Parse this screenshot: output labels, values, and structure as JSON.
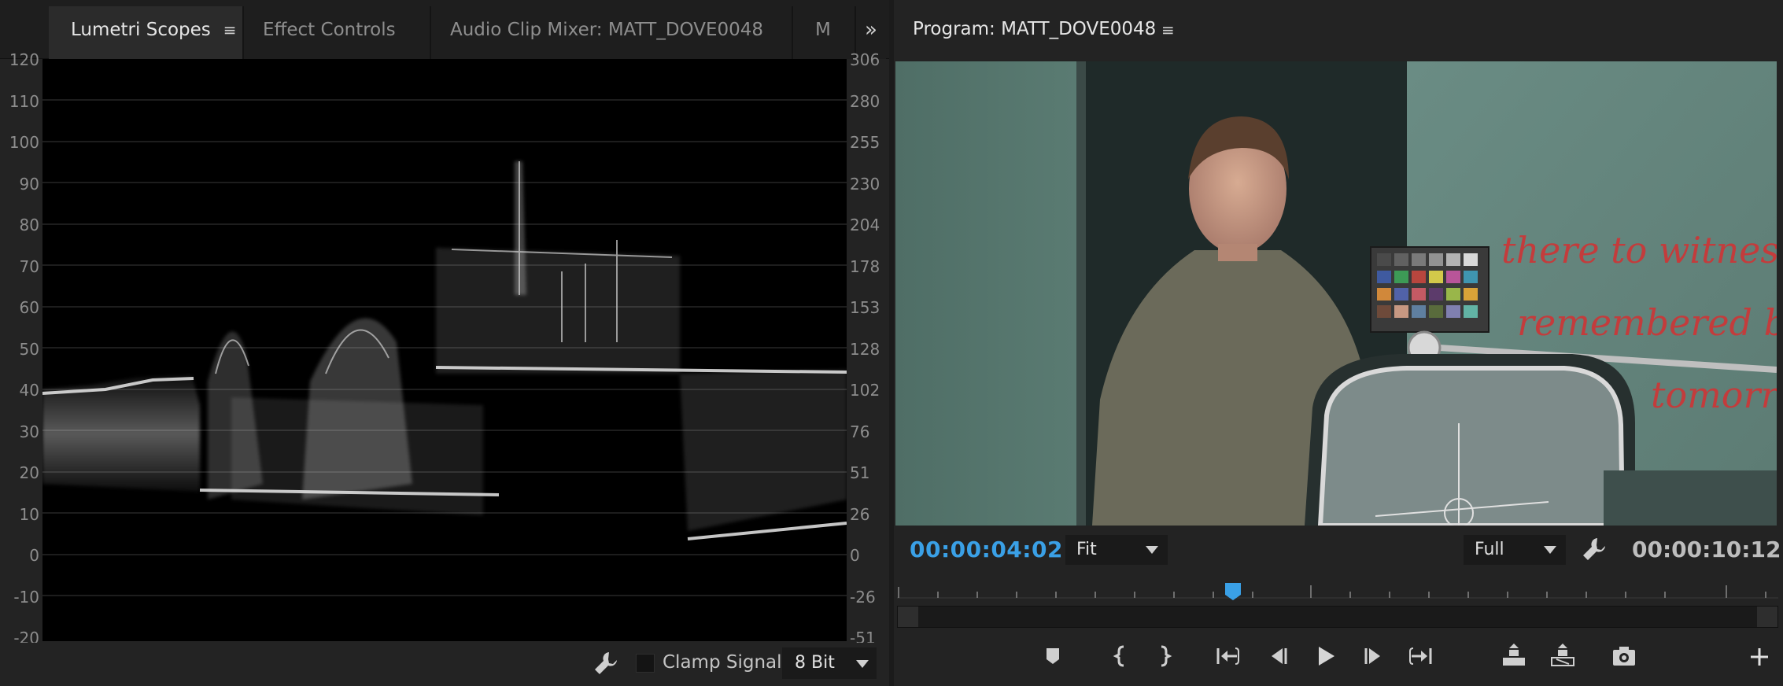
{
  "scopes_panel": {
    "tabs": [
      {
        "label": "Lumetri Scopes",
        "active": true
      },
      {
        "label": "Effect Controls",
        "active": false
      },
      {
        "label": "Audio Clip Mixer: MATT_DOVE0048",
        "active": false
      },
      {
        "label": "M",
        "active": false
      }
    ],
    "menu_glyph": "≡",
    "overflow_glyph": "»",
    "left_axis": [
      "120",
      "110",
      "100",
      "90",
      "80",
      "70",
      "60",
      "50",
      "40",
      "30",
      "20",
      "10",
      "0",
      "-10",
      "-20"
    ],
    "right_axis": [
      "306",
      "280",
      "255",
      "230",
      "204",
      "178",
      "153",
      "128",
      "102",
      "76",
      "51",
      "26",
      "0",
      "-26",
      "-51"
    ],
    "footer": {
      "clamp_label": "Clamp Signal",
      "clamp_checked": false,
      "bit_depth": "8 Bit"
    }
  },
  "program_panel": {
    "title": "Program: MATT_DOVE0048",
    "menu_glyph": "≡",
    "current_timecode": "00:00:04:02",
    "duration_timecode": "00:00:10:12",
    "zoom": "Fit",
    "resolution": "Full",
    "video_text": [
      "there to witness toda",
      "remembered beyond",
      "tomorr"
    ]
  },
  "colors": {
    "timecode_accent": "#3aa0e6",
    "panel_bg": "#232323"
  }
}
